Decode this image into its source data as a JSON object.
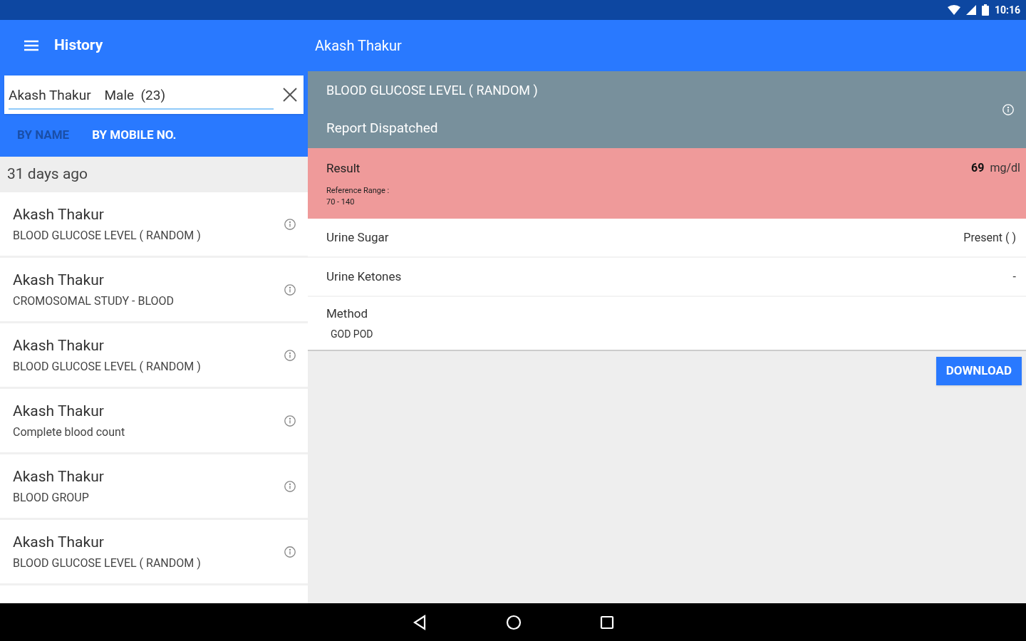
{
  "status_bar": {
    "time": "10:16"
  },
  "app_bar": {
    "title": "History",
    "detail_title": "Akash Thakur"
  },
  "search": {
    "value": "Akash Thakur    Male  (23)"
  },
  "tabs": [
    {
      "label": "BY NAME",
      "selected": false
    },
    {
      "label": "BY MOBILE NO.",
      "selected": true
    }
  ],
  "history": {
    "group": "31 days ago",
    "items": [
      {
        "name": "Akash Thakur",
        "test": "BLOOD GLUCOSE LEVEL ( RANDOM )"
      },
      {
        "name": "Akash Thakur",
        "test": "CROMOSOMAL STUDY - BLOOD"
      },
      {
        "name": "Akash Thakur",
        "test": "BLOOD GLUCOSE LEVEL ( RANDOM )"
      },
      {
        "name": "Akash Thakur",
        "test": "Complete blood count"
      },
      {
        "name": "Akash Thakur",
        "test": "BLOOD GROUP"
      },
      {
        "name": "Akash Thakur",
        "test": "BLOOD GLUCOSE LEVEL ( RANDOM )"
      }
    ]
  },
  "report": {
    "test": "BLOOD GLUCOSE LEVEL ( RANDOM )",
    "status": "Report Dispatched",
    "result": {
      "label": "Result",
      "value": "69",
      "unit": "mg/dl",
      "range_label": "Reference Range :",
      "range": "70 - 140",
      "abnormal": true
    },
    "rows": [
      {
        "kind": "pair",
        "label": "Urine Sugar",
        "value": "Present ( )"
      },
      {
        "kind": "pair",
        "label": "Urine Ketones",
        "value": "-"
      },
      {
        "kind": "stacked",
        "label": "Method",
        "value": "GOD POD"
      }
    ],
    "download": "DOWNLOAD"
  }
}
